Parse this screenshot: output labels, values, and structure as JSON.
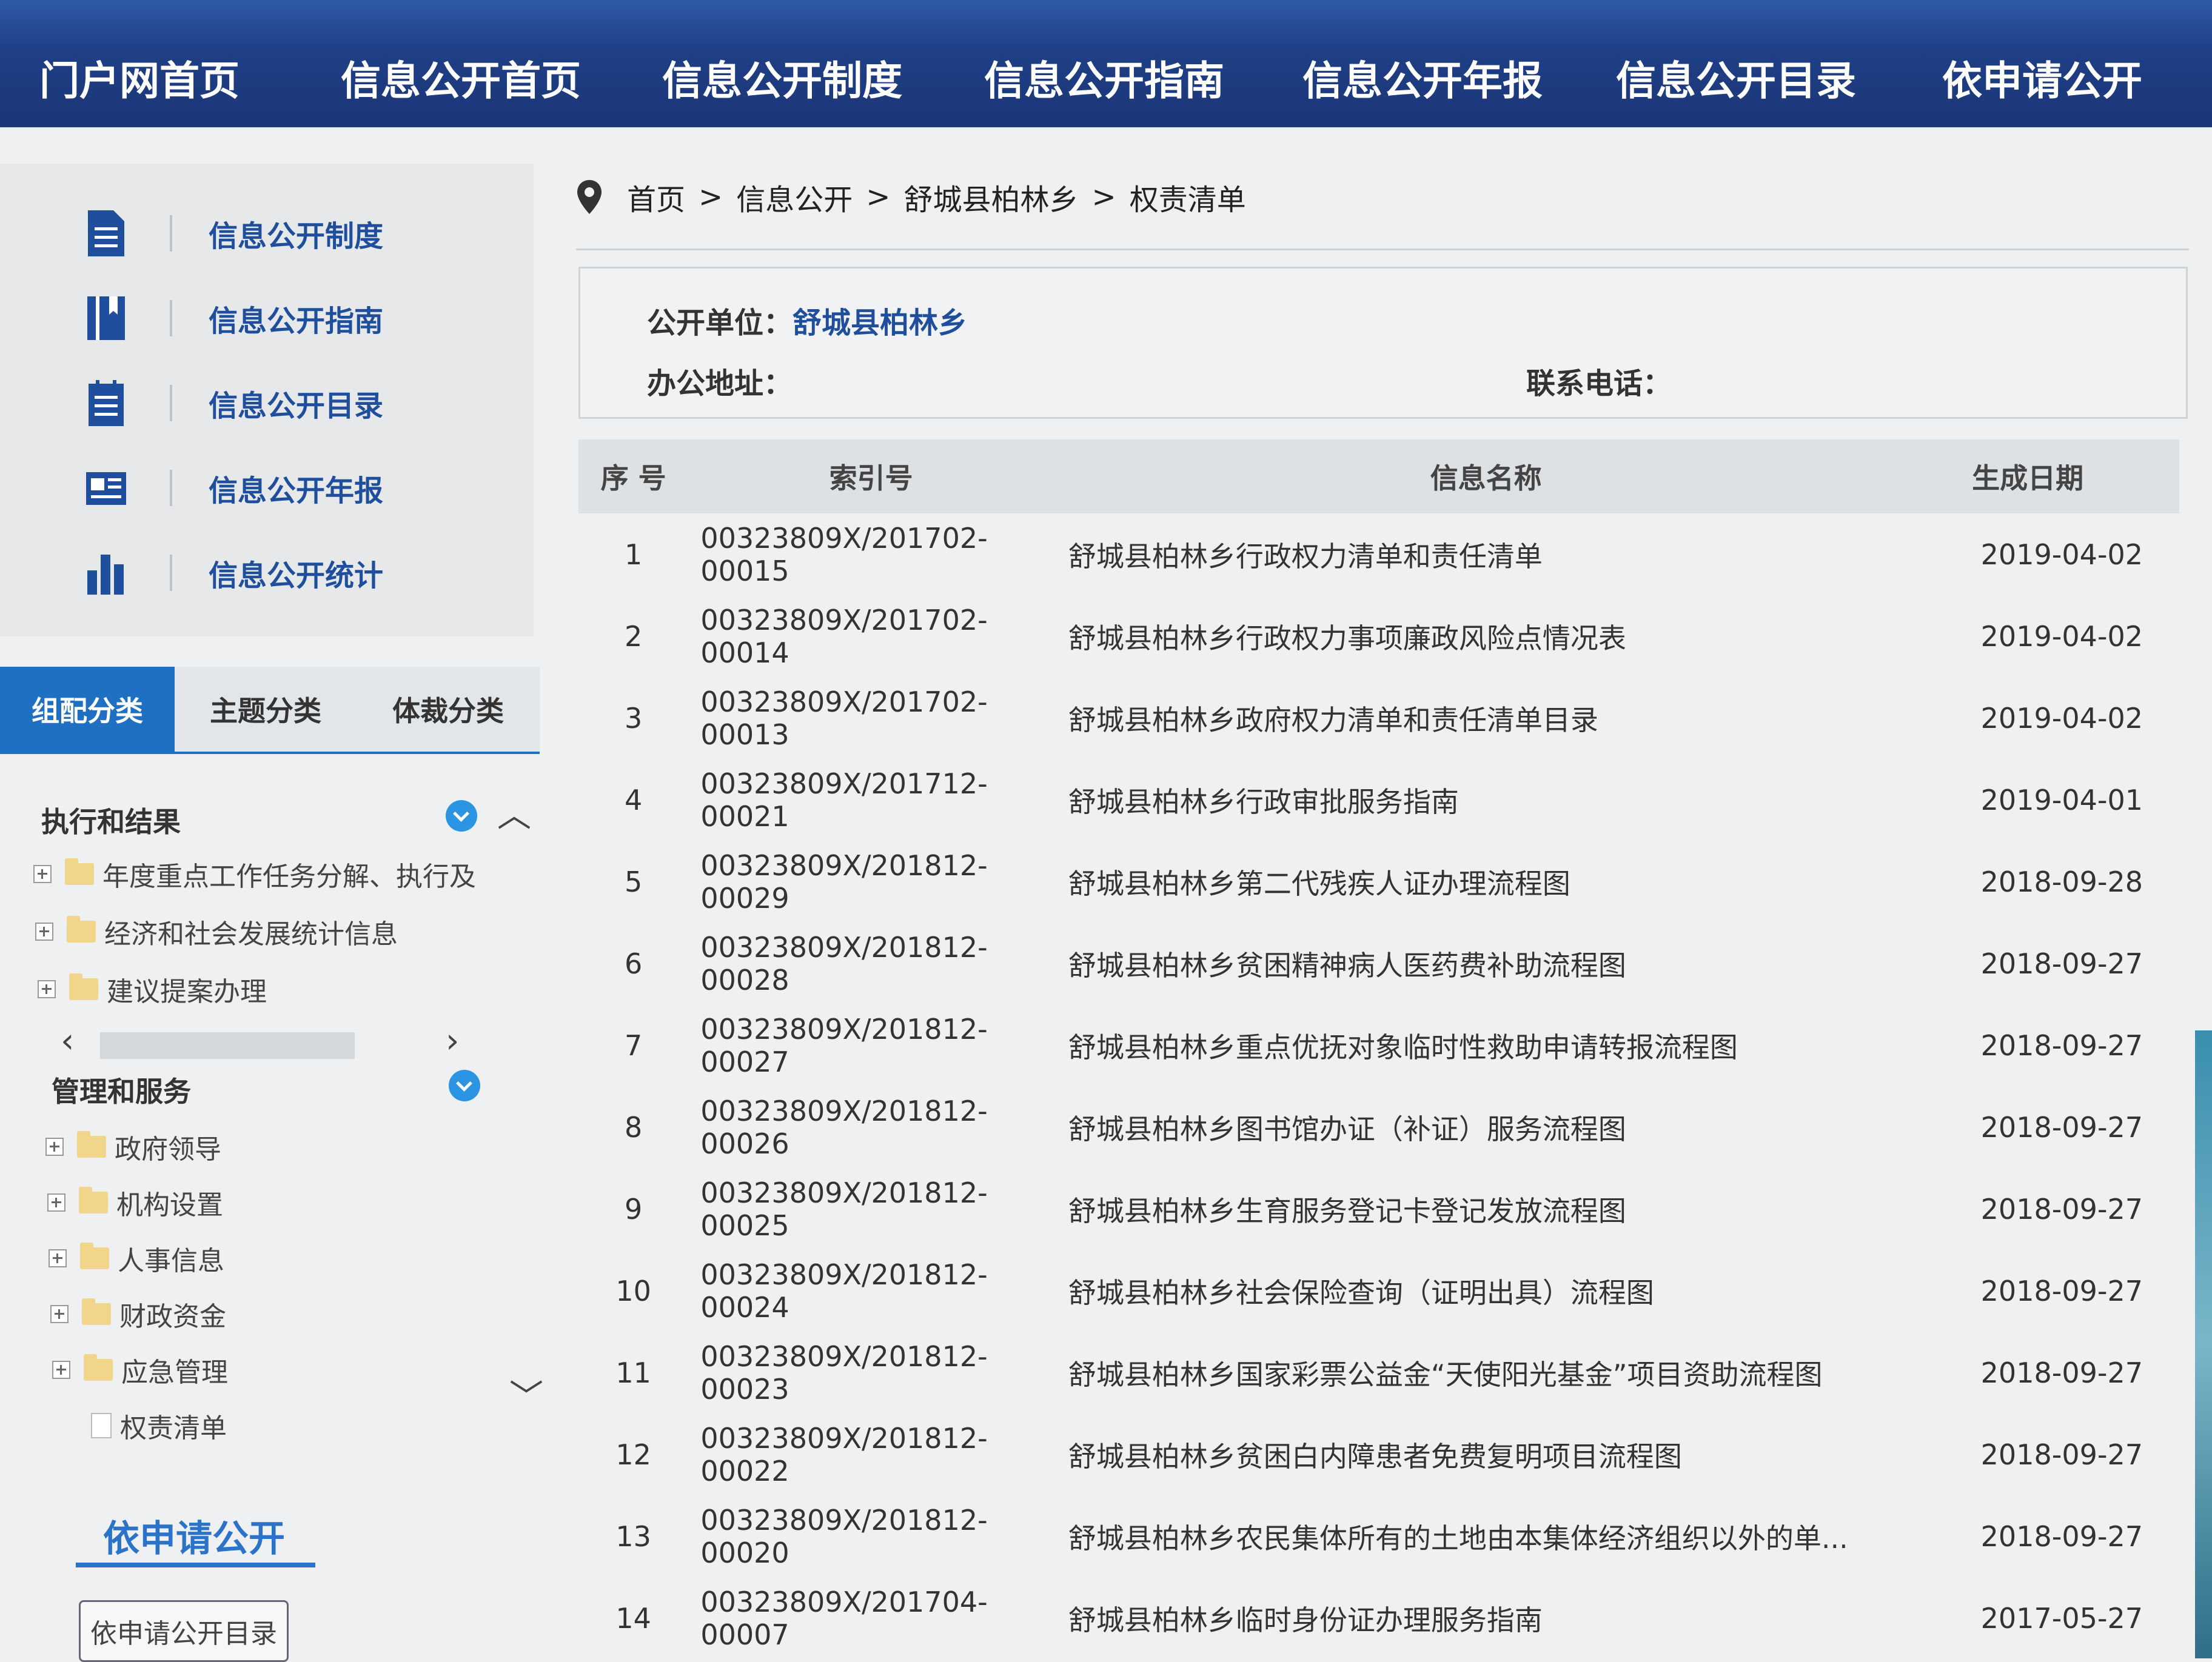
{
  "top_nav": [
    "门户网首页",
    "信息公开首页",
    "信息公开制度",
    "信息公开指南",
    "信息公开年报",
    "信息公开目录",
    "依申请公开"
  ],
  "sidebar": {
    "quick_links": [
      {
        "label": "信息公开制度",
        "icon": "document-icon"
      },
      {
        "label": "信息公开指南",
        "icon": "book-icon"
      },
      {
        "label": "信息公开目录",
        "icon": "list-icon"
      },
      {
        "label": "信息公开年报",
        "icon": "report-icon"
      },
      {
        "label": "信息公开统计",
        "icon": "bar-chart-icon"
      }
    ],
    "tabs": [
      "组配分类",
      "主题分类",
      "体裁分类"
    ],
    "tree": {
      "group1_title": "执行和结果",
      "group1_items": [
        "年度重点工作任务分解、执行及",
        "经济和社会发展统计信息",
        "建议提案办理"
      ],
      "group2_title": "管理和服务",
      "group2_items": [
        "政府领导",
        "机构设置",
        "人事信息",
        "财政资金",
        "应急管理"
      ],
      "selected_leaf": "权责清单"
    },
    "apply_title": "依申请公开",
    "apply_button": "依申请公开目录"
  },
  "breadcrumb": [
    "首页",
    "信息公开",
    "舒城县柏林乡",
    "权责清单"
  ],
  "breadcrumb_sep": ">",
  "info": {
    "unit_label": "公开单位：",
    "unit_value": "舒城县柏林乡",
    "address_label": "办公地址：",
    "phone_label": "联系电话："
  },
  "table": {
    "headers": [
      "序 号",
      "索引号",
      "信息名称",
      "生成日期"
    ],
    "rows": [
      {
        "no": "1",
        "index": "00323809X/201702-00015",
        "name": "舒城县柏林乡行政权力清单和责任清单",
        "date": "2019-04-02"
      },
      {
        "no": "2",
        "index": "00323809X/201702-00014",
        "name": "舒城县柏林乡行政权力事项廉政风险点情况表",
        "date": "2019-04-02"
      },
      {
        "no": "3",
        "index": "00323809X/201702-00013",
        "name": "舒城县柏林乡政府权力清单和责任清单目录",
        "date": "2019-04-02"
      },
      {
        "no": "4",
        "index": "00323809X/201712-00021",
        "name": "舒城县柏林乡行政审批服务指南",
        "date": "2019-04-01"
      },
      {
        "no": "5",
        "index": "00323809X/201812-00029",
        "name": "舒城县柏林乡第二代残疾人证办理流程图",
        "date": "2018-09-28"
      },
      {
        "no": "6",
        "index": "00323809X/201812-00028",
        "name": "舒城县柏林乡贫困精神病人医药费补助流程图",
        "date": "2018-09-27"
      },
      {
        "no": "7",
        "index": "00323809X/201812-00027",
        "name": "舒城县柏林乡重点优抚对象临时性救助申请转报流程图",
        "date": "2018-09-27"
      },
      {
        "no": "8",
        "index": "00323809X/201812-00026",
        "name": "舒城县柏林乡图书馆办证（补证）服务流程图",
        "date": "2018-09-27"
      },
      {
        "no": "9",
        "index": "00323809X/201812-00025",
        "name": "舒城县柏林乡生育服务登记卡登记发放流程图",
        "date": "2018-09-27"
      },
      {
        "no": "10",
        "index": "00323809X/201812-00024",
        "name": "舒城县柏林乡社会保险查询（证明出具）流程图",
        "date": "2018-09-27"
      },
      {
        "no": "11",
        "index": "00323809X/201812-00023",
        "name": "舒城县柏林乡国家彩票公益金“天使阳光基金”项目资助流程图",
        "date": "2018-09-27"
      },
      {
        "no": "12",
        "index": "00323809X/201812-00022",
        "name": "舒城县柏林乡贫困白内障患者免费复明项目流程图",
        "date": "2018-09-27"
      },
      {
        "no": "13",
        "index": "00323809X/201812-00020",
        "name": "舒城县柏林乡农民集体所有的土地由本集体经济组织以外的单...",
        "date": "2018-09-27"
      },
      {
        "no": "14",
        "index": "00323809X/201704-00007",
        "name": "舒城县柏林乡临时身份证办理服务指南",
        "date": "2017-05-27"
      }
    ]
  },
  "colors": {
    "nav_bg": "#1f3f86",
    "accent": "#1f6fc2",
    "link": "#1f4f9c"
  }
}
